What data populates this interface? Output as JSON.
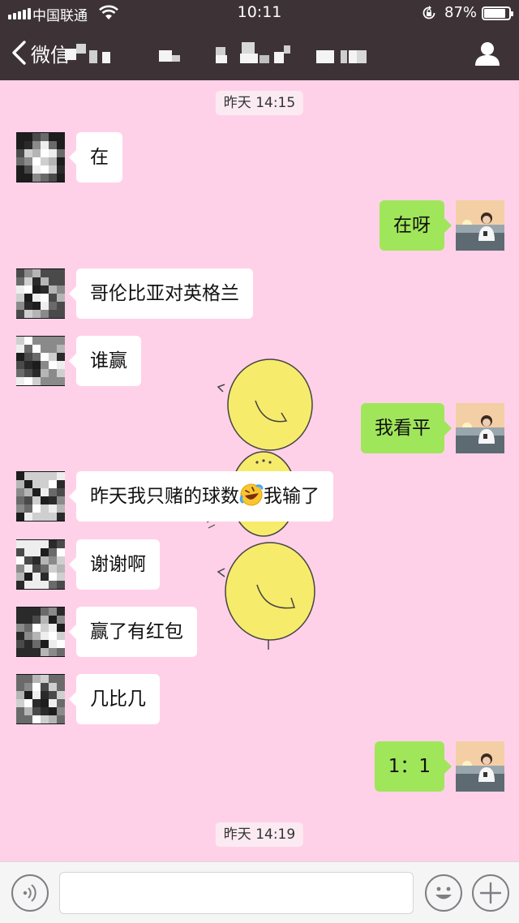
{
  "status_bar": {
    "carrier": "中国联通",
    "time": "10:11",
    "battery_percent": "87%",
    "battery_level": 0.87
  },
  "nav": {
    "back_label": "微信",
    "profile_icon": "person-icon"
  },
  "chat": {
    "timestamps": [
      "昨天 14:15",
      "昨天 14:19"
    ],
    "messages": [
      {
        "side": "left",
        "text": "在"
      },
      {
        "side": "right",
        "text": "在呀"
      },
      {
        "side": "left",
        "text": "哥伦比亚对英格兰"
      },
      {
        "side": "left",
        "text": "谁赢"
      },
      {
        "side": "right",
        "text": "我看平"
      },
      {
        "side": "left",
        "text": "昨天我只赌的球数",
        "emoji": "rofl-emoji",
        "text_after": "我输了"
      },
      {
        "side": "left",
        "text": "谢谢啊"
      },
      {
        "side": "left",
        "text": "赢了有红包"
      },
      {
        "side": "left",
        "text": "几比几"
      },
      {
        "side": "right",
        "text": "1：1"
      }
    ]
  },
  "input_bar": {
    "voice_icon": "voice-icon",
    "emoji_icon": "emoji-icon",
    "plus_icon": "plus-icon",
    "input_value": ""
  },
  "colors": {
    "header_bg": "#3d3337",
    "chat_bg": "#ffd1e8",
    "bubble_received": "#ffffff",
    "bubble_sent": "#a0e65a"
  }
}
